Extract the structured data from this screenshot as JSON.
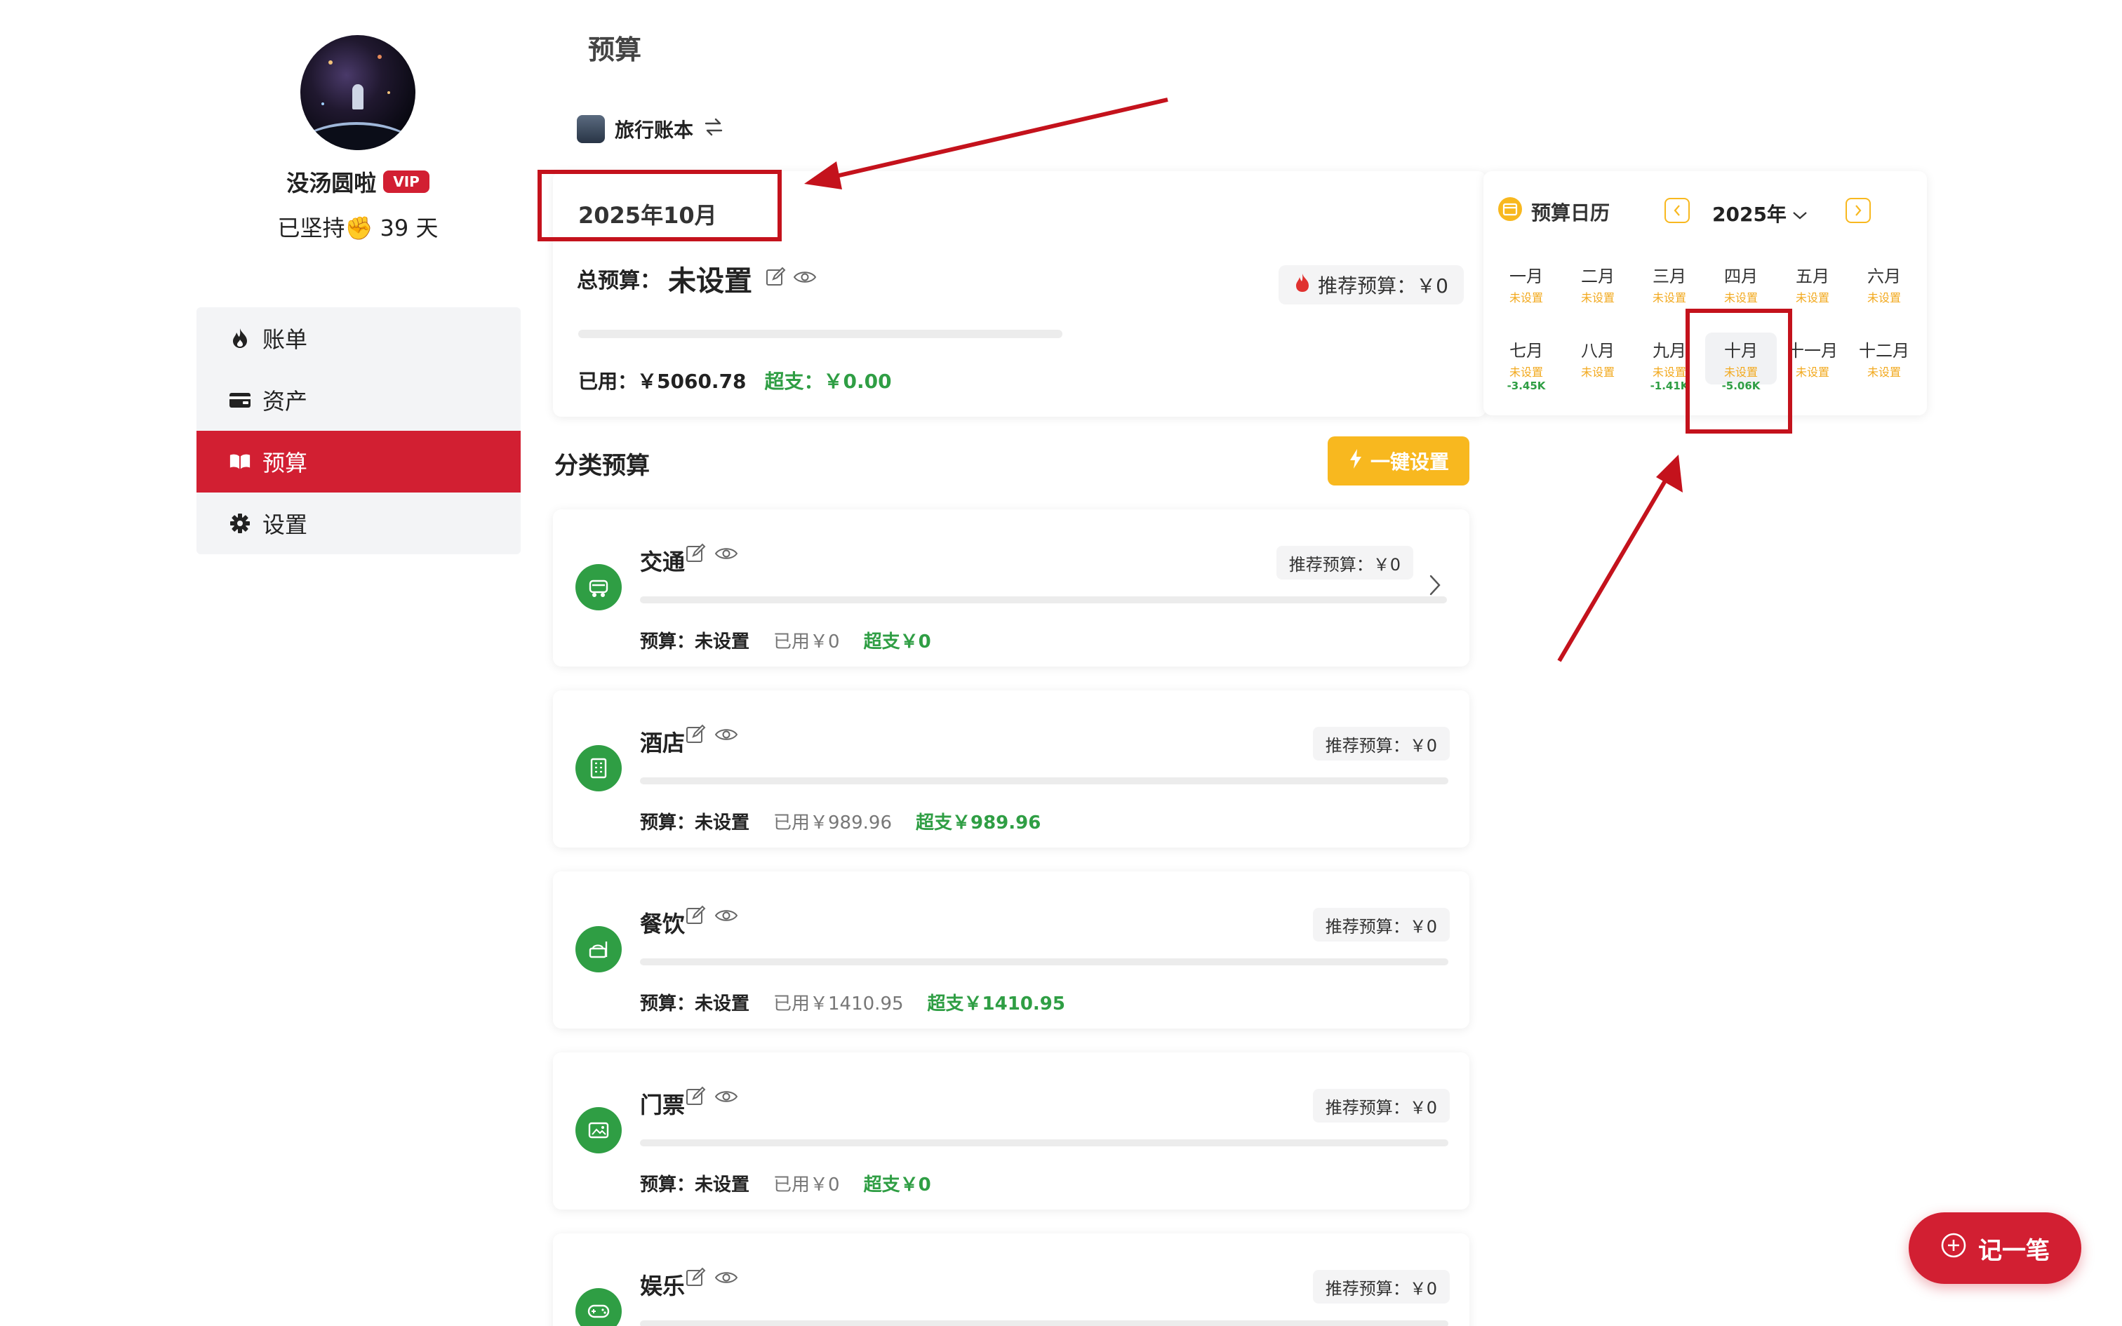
{
  "sidebar": {
    "username": "没汤圆啦",
    "vip": "VIP",
    "streak": "已坚持✊ 39 天",
    "nav": [
      {
        "label": "账单",
        "icon": "flame-icon"
      },
      {
        "label": "资产",
        "icon": "wallet-icon"
      },
      {
        "label": "预算",
        "icon": "book-open-icon",
        "active": true
      },
      {
        "label": "设置",
        "icon": "gear-icon"
      }
    ]
  },
  "main": {
    "title": "预算",
    "book_name": "旅行账本",
    "month": "2025年10月",
    "total_label": "总预算：",
    "total_value": "未设置",
    "recommend": "推荐预算：￥0",
    "used": "已用：￥5060.78",
    "over": "超支：￥0.00",
    "total_progress": 0,
    "section_title": "分类预算",
    "quick_set": "一键设置"
  },
  "categories": [
    {
      "name": "交通",
      "icon": "car-icon",
      "recommend": "推荐预算：￥0",
      "budget": "预算：未设置",
      "used": "已用￥0",
      "over": "超支￥0",
      "progress": 0
    },
    {
      "name": "酒店",
      "icon": "building-icon",
      "recommend": "推荐预算：￥0",
      "budget": "预算：未设置",
      "used": "已用￥989.96",
      "over": "超支￥989.96",
      "progress": 0
    },
    {
      "name": "餐饮",
      "icon": "meal-icon",
      "recommend": "推荐预算：￥0",
      "budget": "预算：未设置",
      "used": "已用￥1410.95",
      "over": "超支￥1410.95",
      "progress": 0
    },
    {
      "name": "门票",
      "icon": "ticket-icon",
      "recommend": "推荐预算：￥0",
      "budget": "预算：未设置",
      "used": "已用￥0",
      "over": "超支￥0",
      "progress": 0
    },
    {
      "name": "娱乐",
      "icon": "gamepad-icon",
      "recommend": "推荐预算：￥0"
    }
  ],
  "calendar": {
    "title": "预算日历",
    "year": "2025年",
    "months": [
      {
        "name": "一月",
        "status": "未设置",
        "value": ""
      },
      {
        "name": "二月",
        "status": "未设置",
        "value": ""
      },
      {
        "name": "三月",
        "status": "未设置",
        "value": ""
      },
      {
        "name": "四月",
        "status": "未设置",
        "value": ""
      },
      {
        "name": "五月",
        "status": "未设置",
        "value": ""
      },
      {
        "name": "六月",
        "status": "未设置",
        "value": ""
      },
      {
        "name": "七月",
        "status": "未设置",
        "value": "-3.45K"
      },
      {
        "name": "八月",
        "status": "未设置",
        "value": ""
      },
      {
        "name": "九月",
        "status": "未设置",
        "value": "-1.41K"
      },
      {
        "name": "十月",
        "status": "未设置",
        "value": "-5.06K",
        "selected": true
      },
      {
        "name": "十一月",
        "status": "未设置",
        "value": ""
      },
      {
        "name": "十二月",
        "status": "未设置",
        "value": ""
      }
    ]
  },
  "fab": {
    "label": "记一笔"
  },
  "colors": {
    "brand_red": "#d21f32",
    "accent_yellow": "#f8b81f",
    "ok_green": "#2f9e44",
    "annotation_red": "#c4121c"
  }
}
